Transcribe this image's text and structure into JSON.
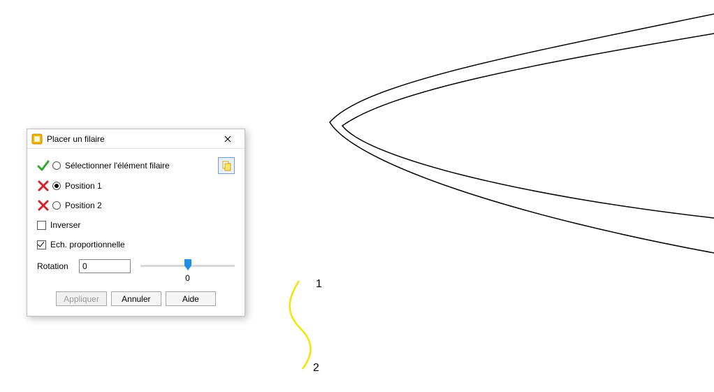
{
  "dialog": {
    "title": "Placer un filaire",
    "step1": {
      "label": "Sélectionner l'élément filaire",
      "done": true,
      "selected": false
    },
    "step2": {
      "label": "Position 1",
      "done": false,
      "selected": true
    },
    "step3": {
      "label": "Position 2",
      "done": false,
      "selected": false
    },
    "invert": {
      "label": "Inverser",
      "checked": false
    },
    "scale": {
      "label": "Ech. proportionnelle",
      "checked": true
    },
    "rotation": {
      "label": "Rotation",
      "value": "0",
      "sliderValue": "0"
    },
    "buttons": {
      "apply": "Appliquer",
      "cancel": "Annuler",
      "help": "Aide"
    }
  },
  "annotations": {
    "label1": "1",
    "label2": "2"
  }
}
